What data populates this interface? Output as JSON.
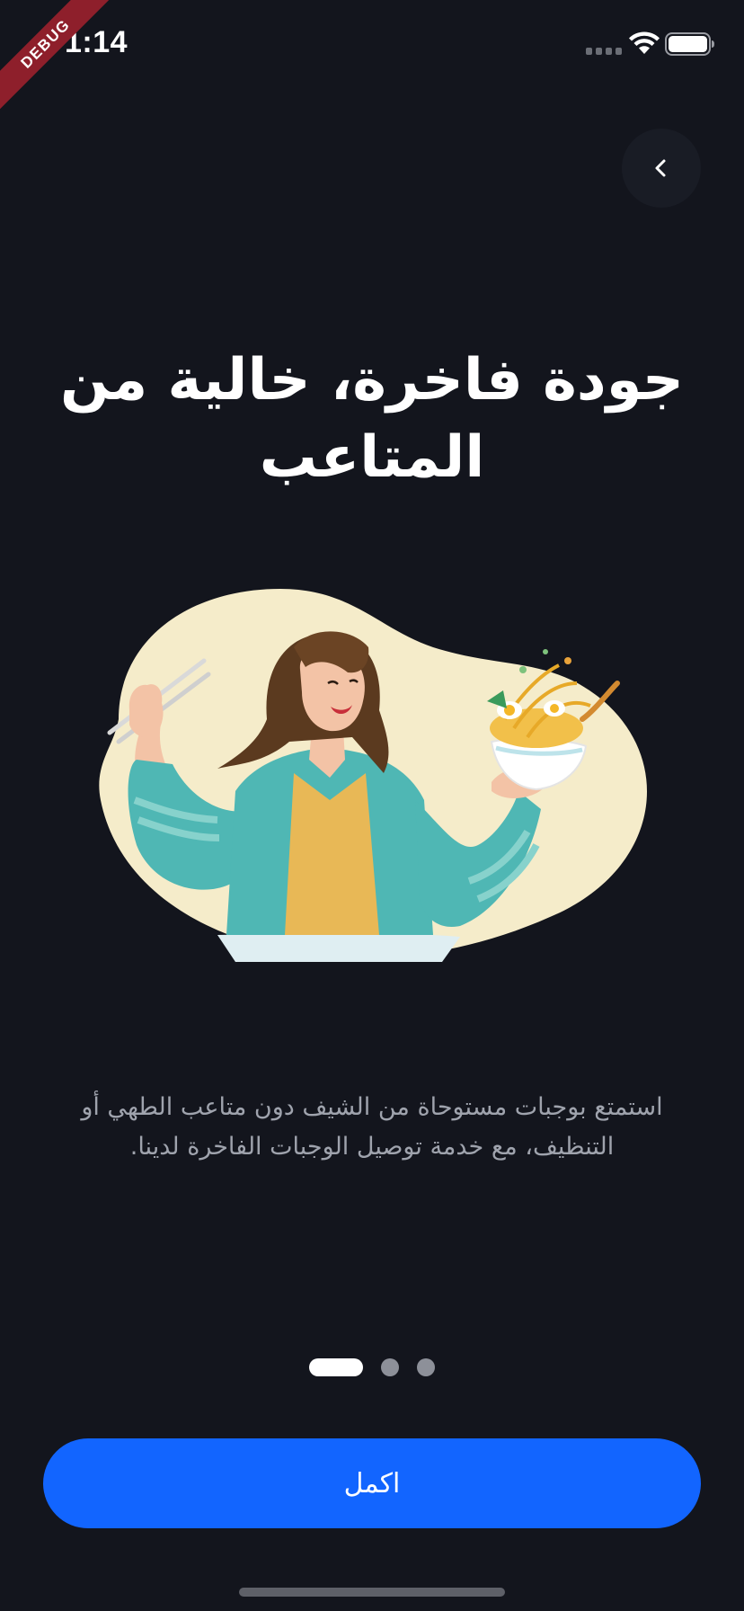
{
  "status_bar": {
    "time": "1:14",
    "icons": [
      "signal-dots-icon",
      "wifi-icon",
      "battery-icon"
    ]
  },
  "debug_banner": "DEBUG",
  "header": {
    "back_icon": "chevron-left-icon"
  },
  "onboarding": {
    "title": "جودة فاخرة، خالية من المتاعب",
    "description": "استمتع بوجبات مستوحاة من الشيف دون متاعب الطهي أو التنظيف، مع خدمة توصيل الوجبات الفاخرة لدينا.",
    "illustration": "woman-eating-ramen-illustration",
    "page_indicator": {
      "total": 3,
      "current": 1
    },
    "continue_label": "اكمل"
  },
  "colors": {
    "background": "#13151d",
    "primary": "#1265ff",
    "text": "#ffffff",
    "muted_text": "#9fa3ad",
    "inactive_dot": "#8d9099",
    "illustration_bg": "#f5ecca"
  }
}
